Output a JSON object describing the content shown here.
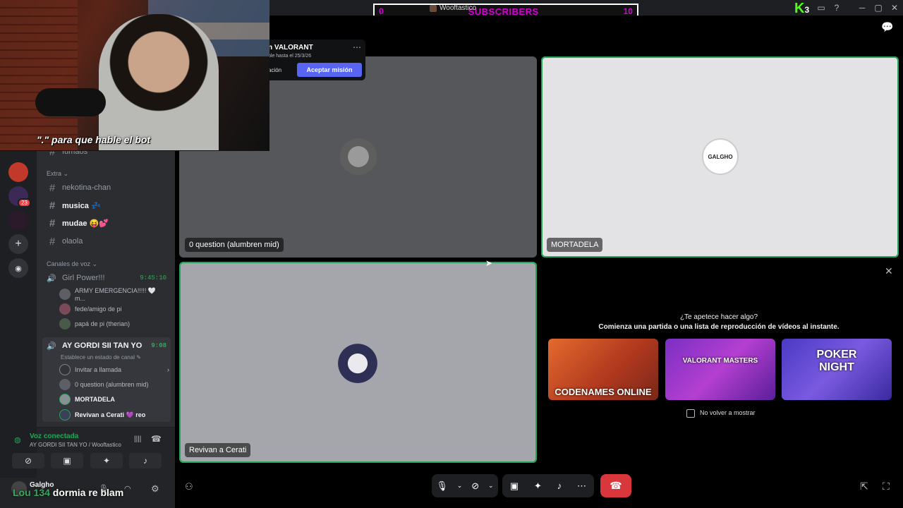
{
  "titlebar": {
    "subscribers_left": "0",
    "subscribers_label": "SUBSCRIBERS",
    "subscribers_right": "10",
    "subscribers_user": "Wooftastico",
    "kick_logo": "K",
    "kick_count": "3",
    "icons": [
      "inbox-icon",
      "help-icon",
      "minimize-icon",
      "maximize-icon",
      "close-icon"
    ]
  },
  "webcam": {
    "caption": "\".\" para que hable el bot"
  },
  "rail": {
    "badge": "23"
  },
  "sidebar": {
    "partial_channel": "fumaos",
    "category_extra": "Extra",
    "text_channels": [
      {
        "name": "nekotina-chan",
        "bold": false
      },
      {
        "name": "musica 💤",
        "bold": true
      },
      {
        "name": "mudae 😝💕",
        "bold": true
      },
      {
        "name": "olaola",
        "bold": false
      }
    ],
    "category_voice": "Canales de voz",
    "voice_channel_1": {
      "name": "Girl Power!!!",
      "time": "9:45:10"
    },
    "voice_channel_1_users": [
      "ARMY EMERGENCIA!!!!! 🤍 m...",
      "fede/amigo de pi",
      "papá de pi (therian)"
    ],
    "voice_channel_2": {
      "name": "AY GORDI SII TAN YO",
      "time": "9:08",
      "status": "Establece un estado de canal"
    },
    "invite": "Invitar a llamada",
    "voice_channel_2_users": [
      "0 question (alumbren mid)",
      "MORTADELA",
      "Revivan a Cerati 💜 reo"
    ]
  },
  "voice_panel": {
    "title": "Voz conectada",
    "subtitle": "AY GORDI SII TAN YO / Wooftastico"
  },
  "user_panel": {
    "username": "Galgho",
    "overlay_tag": "Lou 134",
    "overlay_text": "dormia re blam"
  },
  "popup": {
    "title": "n VALORANT",
    "subtitle": "ble hasta el 25/3/26",
    "secondary": "ación",
    "primary": "Aceptar misión"
  },
  "tiles": {
    "t1": "0 question (alumbren mid)",
    "t2": "MORTADELA",
    "t2_logo": "GALGHO",
    "t3": "Revivan a Cerati"
  },
  "activity": {
    "question": "¿Te apetece hacer algo?",
    "prompt": "Comienza una partida o una lista de reproducción de vídeos al instante.",
    "cards": [
      "CODENAMES ONLINE",
      "VALORANT MASTERS",
      "POKER NIGHT"
    ],
    "dont_show": "No volver a mostrar"
  }
}
